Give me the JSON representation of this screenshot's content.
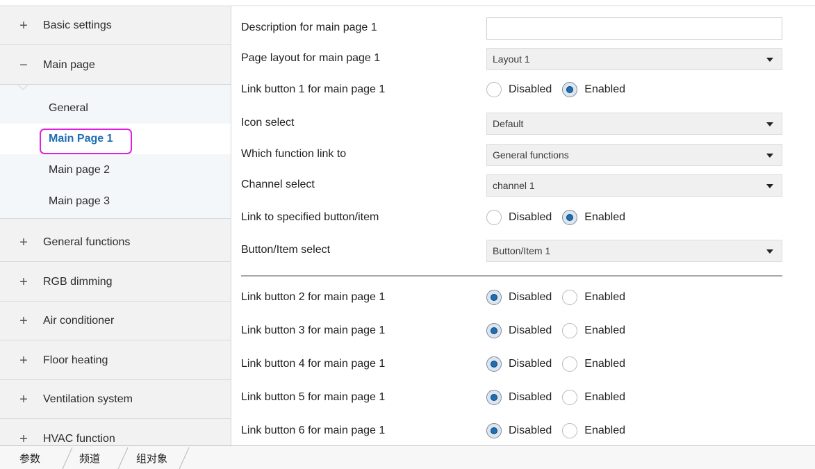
{
  "sidebar": {
    "items": [
      {
        "sign": "+",
        "label": "Basic settings"
      },
      {
        "sign": "−",
        "label": "Main page"
      },
      {
        "sign": "+",
        "label": "General functions"
      },
      {
        "sign": "+",
        "label": "RGB dimming"
      },
      {
        "sign": "+",
        "label": "Air conditioner"
      },
      {
        "sign": "+",
        "label": "Floor heating"
      },
      {
        "sign": "+",
        "label": "Ventilation system"
      },
      {
        "sign": "+",
        "label": "HVAC function"
      }
    ],
    "sub_items": [
      {
        "label": "General"
      },
      {
        "label": "Main Page 1"
      },
      {
        "label": "Main page 2"
      },
      {
        "label": "Main page 3"
      }
    ],
    "highlight_color": "#e020e0",
    "active_color": "#1f6fb4"
  },
  "params": {
    "description": {
      "label": "Description for main page 1",
      "value": ""
    },
    "layout": {
      "label": "Page layout for main page 1",
      "value": "Layout 1"
    },
    "link1": {
      "label": "Link button 1 for main page 1",
      "selected": "Enabled"
    },
    "icon": {
      "label": "Icon select",
      "value": "Default"
    },
    "function": {
      "label": "Which function link to",
      "value": "General functions"
    },
    "channel": {
      "label": "Channel select",
      "value": "channel 1"
    },
    "link_specified": {
      "label": "Link to specified button/item",
      "selected": "Enabled"
    },
    "button_item": {
      "label": "Button/Item select",
      "value": "Button/Item 1"
    },
    "link2": {
      "label": "Link button 2 for main page 1",
      "selected": "Disabled"
    },
    "link3": {
      "label": "Link button 3 for main page 1",
      "selected": "Disabled"
    },
    "link4": {
      "label": "Link button 4 for main page 1",
      "selected": "Disabled"
    },
    "link5": {
      "label": "Link button 5 for main page 1",
      "selected": "Disabled"
    },
    "link6": {
      "label": "Link button 6 for main page 1",
      "selected": "Disabled"
    }
  },
  "radio_options": {
    "disabled": "Disabled",
    "enabled": "Enabled"
  },
  "tabs": [
    {
      "label": "参数"
    },
    {
      "label": "频道"
    },
    {
      "label": "组对象"
    }
  ]
}
